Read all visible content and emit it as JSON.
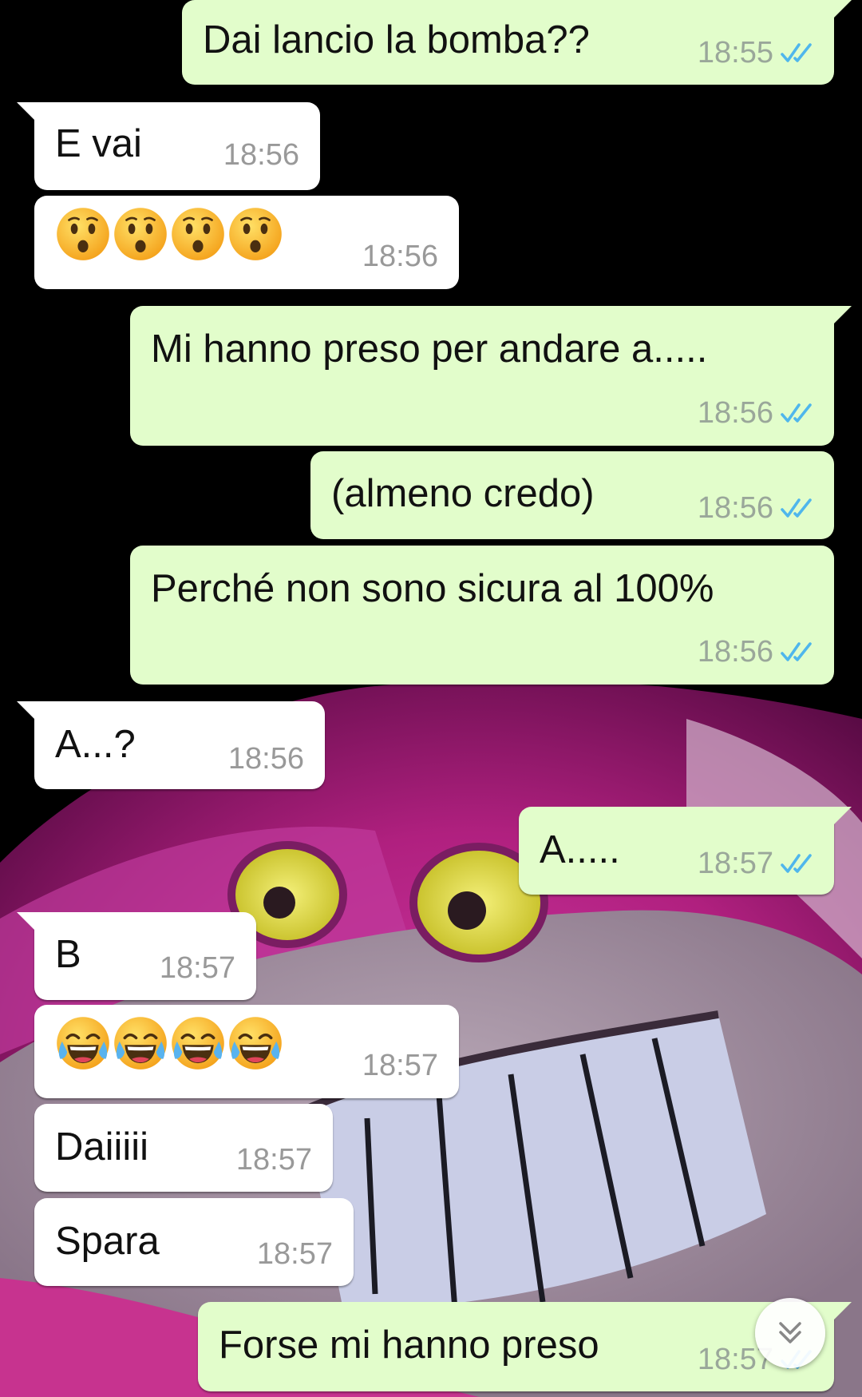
{
  "theme": {
    "outgoing_bubble": "#e2fdcb",
    "incoming_bubble": "#ffffff",
    "read_tick": "#4fb6ec",
    "wallpaper": "magenta plush grinning cat on black"
  },
  "messages": [
    {
      "dir": "out",
      "text": "Dai lancio la bomba??",
      "time": "18:55",
      "status": "read"
    },
    {
      "dir": "in",
      "text": "E vai",
      "time": "18:56"
    },
    {
      "dir": "in",
      "emoji": [
        "hushed-face",
        "hushed-face",
        "hushed-face",
        "hushed-face"
      ],
      "time": "18:56"
    },
    {
      "dir": "out",
      "text": "Mi hanno preso per andare a.....",
      "time": "18:56",
      "status": "read"
    },
    {
      "dir": "out",
      "text": "(almeno credo)",
      "time": "18:56",
      "status": "read"
    },
    {
      "dir": "out",
      "text": "Perché non sono sicura al 100%",
      "time": "18:56",
      "status": "read"
    },
    {
      "dir": "in",
      "text": "A...?",
      "time": "18:56"
    },
    {
      "dir": "out",
      "text": "A.....",
      "time": "18:57",
      "status": "read"
    },
    {
      "dir": "in",
      "text": "B",
      "time": "18:57"
    },
    {
      "dir": "in",
      "emoji": [
        "tears-of-joy-face",
        "tears-of-joy-face",
        "tears-of-joy-face",
        "tears-of-joy-face"
      ],
      "time": "18:57"
    },
    {
      "dir": "in",
      "text": "Daiiiii",
      "time": "18:57"
    },
    {
      "dir": "in",
      "text": "Spara",
      "time": "18:57"
    },
    {
      "dir": "out",
      "text": "Forse mi hanno preso",
      "time": "18:57",
      "status": "read"
    }
  ],
  "scroll_button": {
    "icon": "double-chevron-down-icon"
  }
}
